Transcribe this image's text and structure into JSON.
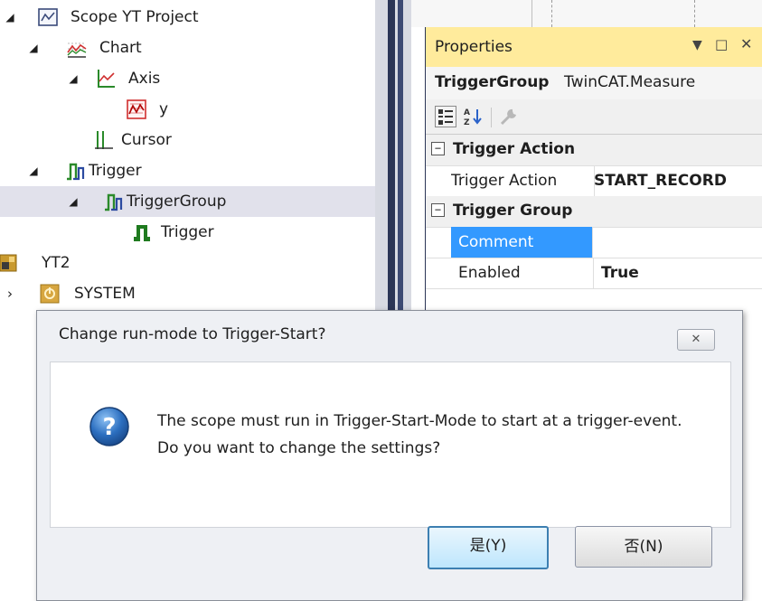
{
  "tree": {
    "items": [
      {
        "label": "Scope YT Project",
        "icon": "scope-project-icon"
      },
      {
        "label": "Chart",
        "icon": "chart-icon"
      },
      {
        "label": "Axis",
        "icon": "axis-icon"
      },
      {
        "label": "y",
        "icon": "channel-icon"
      },
      {
        "label": "Cursor",
        "icon": "cursor-icon"
      },
      {
        "label": "Trigger",
        "icon": "trigger-icon"
      },
      {
        "label": "TriggerGroup",
        "icon": "trigger-group-icon"
      },
      {
        "label": "Trigger",
        "icon": "trigger-item-icon"
      },
      {
        "label": "YT2",
        "icon": "yt2-icon"
      },
      {
        "label": "SYSTEM",
        "icon": "system-icon"
      }
    ]
  },
  "properties": {
    "title": "Properties",
    "object_name": "TriggerGroup",
    "object_type": "TwinCAT.Measure",
    "categories": [
      {
        "name": "Trigger Action",
        "rows": [
          {
            "name": "Trigger Action",
            "value": "START_RECORD"
          }
        ]
      },
      {
        "name": "Trigger Group",
        "rows": [
          {
            "name": "Comment",
            "value": ""
          },
          {
            "name": "Enabled",
            "value": "True"
          }
        ]
      }
    ]
  },
  "dialog": {
    "title": "Change run-mode to Trigger-Start?",
    "message": "The scope must run in Trigger-Start-Mode to start at a trigger-event. Do you want to change the settings?",
    "yes_label": "是(Y)",
    "no_label": "否(N)",
    "icon": "question-icon"
  },
  "colors": {
    "selection": "#e1e1eb",
    "properties_title": "#ffeb9c",
    "selected_property": "#3399ff"
  }
}
